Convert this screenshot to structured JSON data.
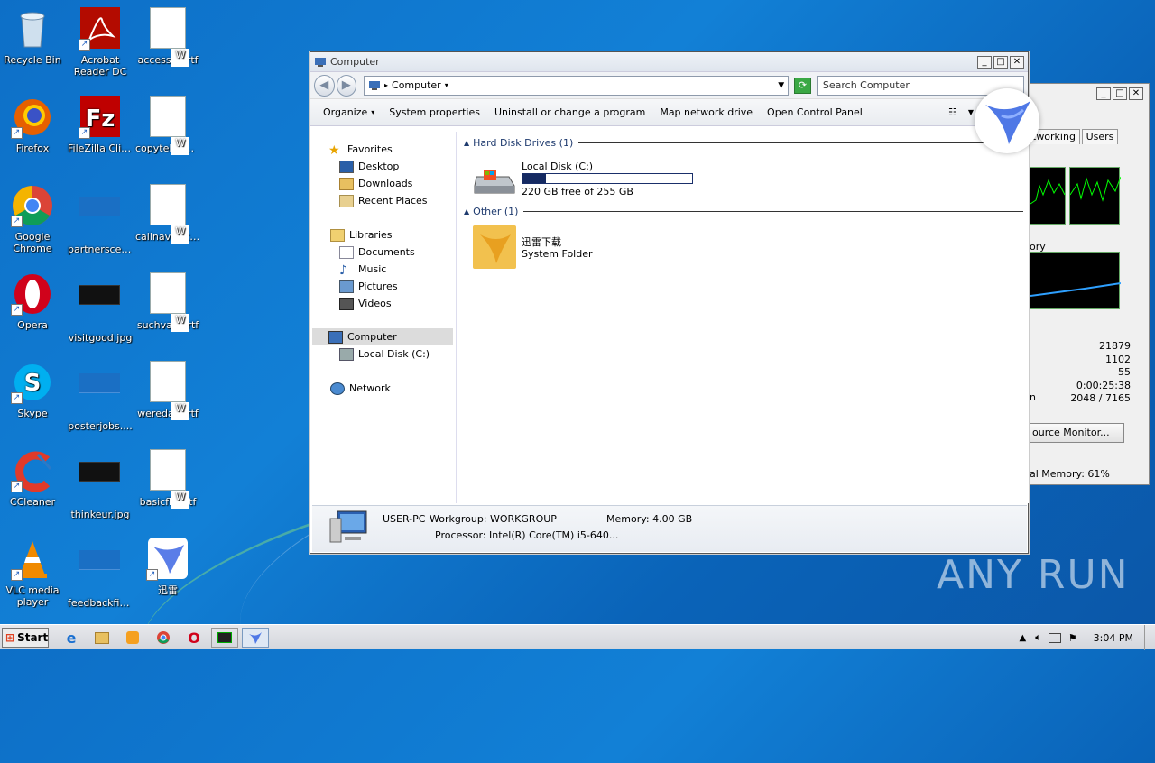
{
  "desktop": {
    "icons": [
      {
        "label": "Recycle Bin"
      },
      {
        "label": "Acrobat Reader DC"
      },
      {
        "label": "accesseg.rtf"
      },
      {
        "label": "Firefox"
      },
      {
        "label": "FileZilla Client"
      },
      {
        "label": "copytelepho..."
      },
      {
        "label": "Google Chrome"
      },
      {
        "label": "partnerscell..."
      },
      {
        "label": "callnavigati..."
      },
      {
        "label": "Opera"
      },
      {
        "label": "visitgood.jpg"
      },
      {
        "label": "suchvalid.rtf"
      },
      {
        "label": "Skype"
      },
      {
        "label": "posterjobs...."
      },
      {
        "label": "weredark.rtf"
      },
      {
        "label": "CCleaner"
      },
      {
        "label": "thinkeur.jpg"
      },
      {
        "label": "basicflat.rtf"
      },
      {
        "label": "VLC media player"
      },
      {
        "label": "feedbackfin..."
      },
      {
        "label": "迅雷"
      }
    ]
  },
  "explorer": {
    "title": "Computer",
    "address": "Computer",
    "search_placeholder": "Search Computer",
    "commands": [
      "Organize",
      "System properties",
      "Uninstall or change a program",
      "Map network drive",
      "Open Control Panel"
    ],
    "nav": {
      "favorites": "Favorites",
      "desktop": "Desktop",
      "downloads": "Downloads",
      "recent": "Recent Places",
      "libraries": "Libraries",
      "documents": "Documents",
      "music": "Music",
      "pictures": "Pictures",
      "videos": "Videos",
      "computer": "Computer",
      "localdisk": "Local Disk (C:)",
      "network": "Network"
    },
    "sections": {
      "hdd": "Hard Disk Drives (1)",
      "other": "Other (1)"
    },
    "drive": {
      "name": "Local Disk (C:)",
      "free": "220 GB free of 255 GB",
      "used_fraction": 0.14
    },
    "folder": {
      "name": "迅雷下载",
      "type": "System Folder"
    },
    "details": {
      "pc": "USER-PC",
      "workgroup": "Workgroup: WORKGROUP",
      "memory": "Memory: 4.00 GB",
      "processor": "Processor: Intel(R) Core(TM) i5-640..."
    }
  },
  "taskmgr": {
    "tab_networking": "tworking",
    "tab_users": "Users",
    "mem_label": "ory",
    "stats": [
      "21879",
      "1102",
      "55",
      "0:00:25:38",
      "2048 / 7165"
    ],
    "stat_prefix": "n",
    "button": "ource Monitor...",
    "footer": "al Memory: 61%"
  },
  "taskbar": {
    "start": "Start",
    "time": "3:04 PM"
  },
  "watermark": "ANY RUN"
}
